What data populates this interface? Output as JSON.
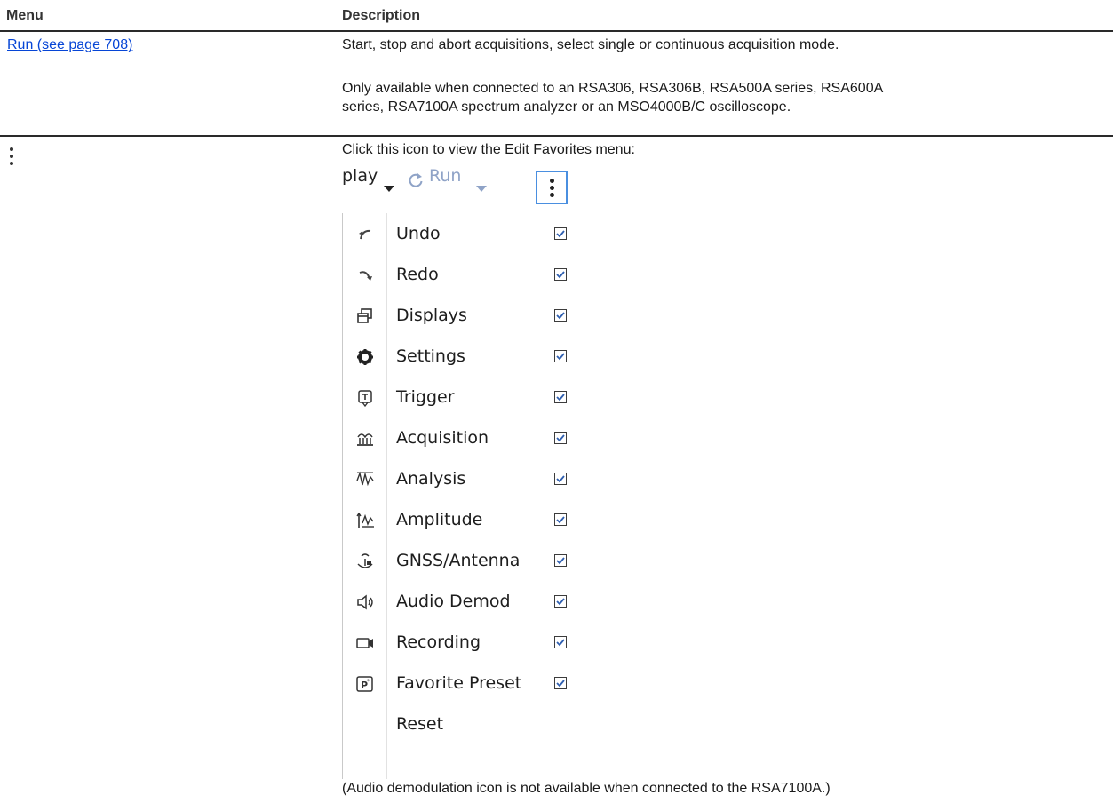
{
  "table": {
    "headers": [
      "Menu",
      "Description"
    ],
    "row1": {
      "menu_link": "Run (see page 708)",
      "desc_line1": "Start, stop and abort acquisitions, select single or continuous acquisition mode.",
      "desc_line2": "Only available when connected to an RSA306, RSA306B, RSA500A series, RSA600A",
      "desc_line3": "series, RSA7100A spectrum analyzer or an MSO4000B/C oscilloscope."
    },
    "row2": {
      "menu_icon": "kebab-menu-icon",
      "desc_line1": "Click this icon to view the Edit Favorites menu:",
      "note": "(Audio demodulation icon is not available when connected to the RSA7100A.)"
    }
  },
  "menu_screenshot": {
    "toolbar": {
      "display_label": "play",
      "run_label": "Run",
      "kebab_icon": "kebab-menu-icon"
    },
    "items": [
      {
        "label": "Undo",
        "icon": "undo-icon",
        "checked": true
      },
      {
        "label": "Redo",
        "icon": "redo-icon",
        "checked": true
      },
      {
        "label": "Displays",
        "icon": "displays-icon",
        "checked": true
      },
      {
        "label": "Settings",
        "icon": "gear-icon",
        "checked": true
      },
      {
        "label": "Trigger",
        "icon": "trigger-icon",
        "checked": true
      },
      {
        "label": "Acquisition",
        "icon": "acquisition-icon",
        "checked": true
      },
      {
        "label": "Analysis",
        "icon": "analysis-icon",
        "checked": true
      },
      {
        "label": "Amplitude",
        "icon": "amplitude-icon",
        "checked": true
      },
      {
        "label": "GNSS/Antenna",
        "icon": "antenna-icon",
        "checked": true
      },
      {
        "label": "Audio Demod",
        "icon": "speaker-icon",
        "checked": true
      },
      {
        "label": "Recording",
        "icon": "video-camera-icon",
        "checked": true
      },
      {
        "label": "Favorite Preset",
        "icon": "preset-icon",
        "checked": true
      },
      {
        "label": "Reset",
        "icon": "",
        "checked": false
      }
    ],
    "colors": {
      "run_disabled": "#8fa3c7",
      "kebab_focus": "#4a8fe0",
      "link": "#0645d6"
    }
  }
}
